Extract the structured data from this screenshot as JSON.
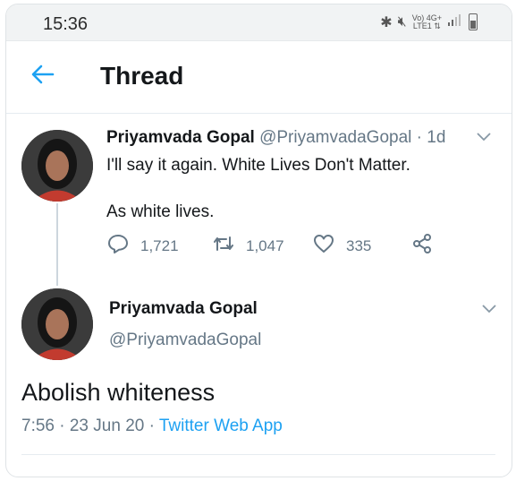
{
  "status_bar": {
    "time": "15:36",
    "network_top": "Vo) 4G+",
    "network_bottom": "LTE1 ⇅"
  },
  "header": {
    "title": "Thread"
  },
  "tweet1": {
    "name": "Priyamvada Gopal",
    "handle": "@PriyamvadaGopal",
    "age": "· 1d",
    "line1": "I'll say it again. White Lives Don't Matter.",
    "line2": "As white lives.",
    "replies": "1,721",
    "retweets": "1,047",
    "likes": "335"
  },
  "tweet2": {
    "name": "Priyamvada Gopal",
    "handle": "@PriyamvadaGopal",
    "text": "Abolish whiteness",
    "timestamp": "7:56 · 23 Jun 20 · ",
    "source": "Twitter Web App"
  },
  "colors": {
    "accent": "#1da1f2",
    "muted": "#657786",
    "text": "#14171a"
  },
  "icons": [
    "back-arrow-icon",
    "bluetooth-icon",
    "mute-icon",
    "signal-icon",
    "battery-icon",
    "reply-icon",
    "retweet-icon",
    "like-icon",
    "share-icon",
    "chevron-down-icon"
  ]
}
